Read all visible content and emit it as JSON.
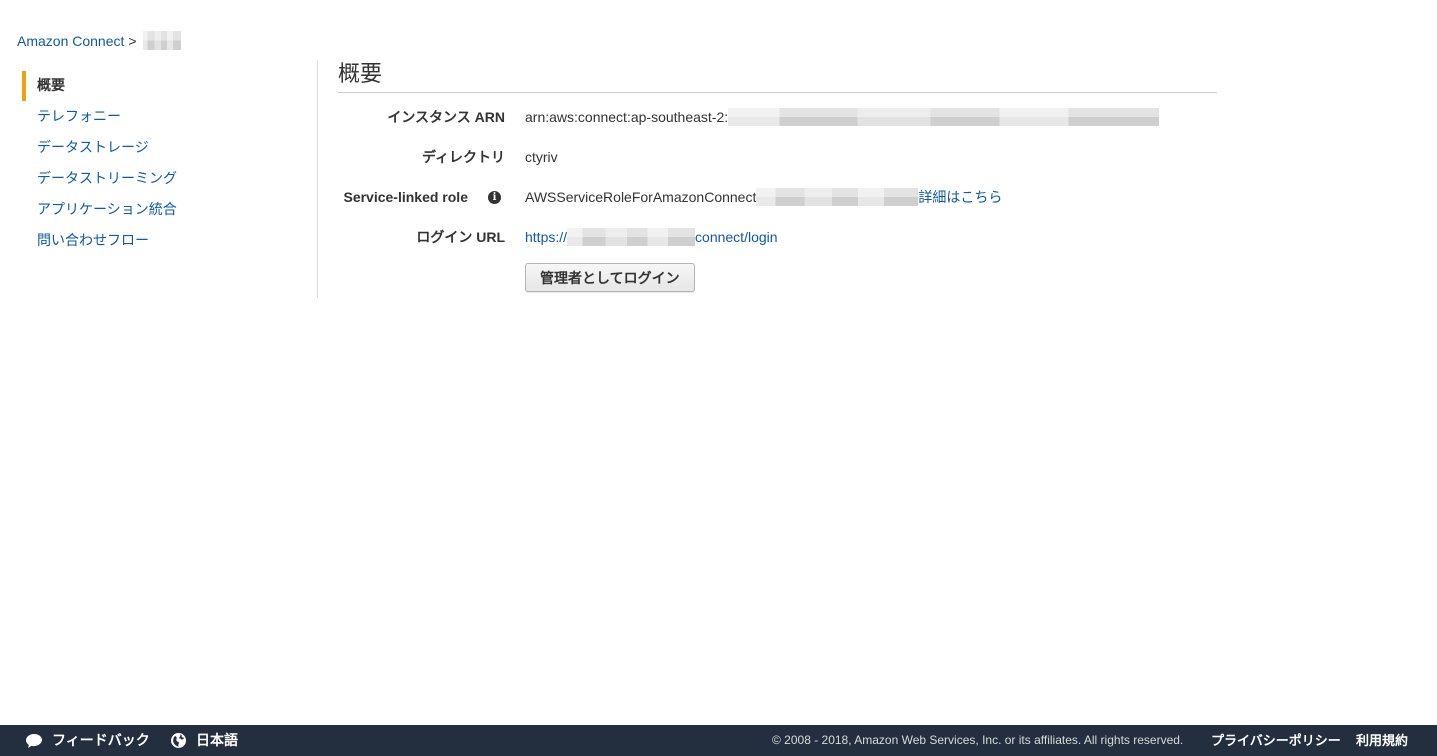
{
  "breadcrumb": {
    "root": "Amazon Connect",
    "separator": ">"
  },
  "sidebar": {
    "items": [
      {
        "label": "概要",
        "active": true
      },
      {
        "label": "テレフォニー",
        "active": false
      },
      {
        "label": "データストレージ",
        "active": false
      },
      {
        "label": "データストリーミング",
        "active": false
      },
      {
        "label": "アプリケーション統合",
        "active": false
      },
      {
        "label": "問い合わせフロー",
        "active": false
      }
    ]
  },
  "main": {
    "title": "概要",
    "rows": {
      "arn": {
        "label": "インスタンス ARN",
        "value": "arn:aws:connect:ap-southeast-2:"
      },
      "directory": {
        "label": "ディレクトリ",
        "value": "ctyriv"
      },
      "role": {
        "label": "Service-linked role",
        "value": "AWSServiceRoleForAmazonConnect",
        "link": "詳細はこちら"
      },
      "login": {
        "label": "ログイン URL",
        "url_prefix": "https://",
        "url_suffix": "connect/login"
      }
    },
    "login_button": "管理者としてログイン"
  },
  "footer": {
    "feedback": "フィードバック",
    "language": "日本語",
    "copyright": "© 2008 - 2018, Amazon Web Services, Inc. or its affiliates. All rights reserved.",
    "privacy": "プライバシーポリシー",
    "terms": "利用規約"
  },
  "colors": {
    "link": "#0f5aa8",
    "active_indicator": "#f0a20f",
    "footer_bg": "#232f3e"
  }
}
